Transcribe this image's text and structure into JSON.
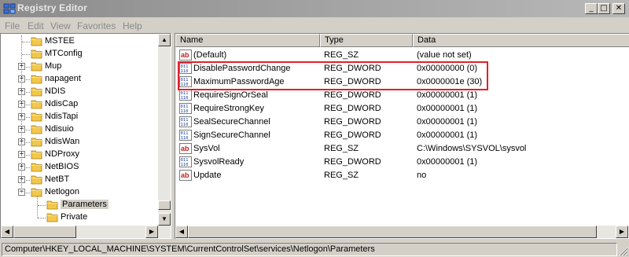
{
  "window": {
    "title": "Registry Editor",
    "controls": {
      "minimize": "_",
      "maximize": "□",
      "close": "✕"
    }
  },
  "menu": {
    "items": [
      "File",
      "Edit",
      "View",
      "Favorites",
      "Help"
    ]
  },
  "tree": {
    "items": [
      {
        "label": "MSTEE",
        "expandable": false,
        "level": 0,
        "selected": false
      },
      {
        "label": "MTConfig",
        "expandable": false,
        "level": 0,
        "selected": false
      },
      {
        "label": "Mup",
        "expandable": true,
        "level": 0,
        "selected": false
      },
      {
        "label": "napagent",
        "expandable": true,
        "level": 0,
        "selected": false
      },
      {
        "label": "NDIS",
        "expandable": true,
        "level": 0,
        "selected": false
      },
      {
        "label": "NdisCap",
        "expandable": true,
        "level": 0,
        "selected": false
      },
      {
        "label": "NdisTapi",
        "expandable": true,
        "level": 0,
        "selected": false
      },
      {
        "label": "Ndisuio",
        "expandable": true,
        "level": 0,
        "selected": false
      },
      {
        "label": "NdisWan",
        "expandable": true,
        "level": 0,
        "selected": false
      },
      {
        "label": "NDProxy",
        "expandable": true,
        "level": 0,
        "selected": false
      },
      {
        "label": "NetBIOS",
        "expandable": true,
        "level": 0,
        "selected": false
      },
      {
        "label": "NetBT",
        "expandable": true,
        "level": 0,
        "selected": false
      },
      {
        "label": "Netlogon",
        "expandable": true,
        "level": 0,
        "selected": false,
        "expanded": true
      },
      {
        "label": "Parameters",
        "expandable": false,
        "level": 1,
        "selected": true
      },
      {
        "label": "Private",
        "expandable": false,
        "level": 1,
        "selected": false
      }
    ]
  },
  "list": {
    "columns": [
      "Name",
      "Type",
      "Data"
    ],
    "rows": [
      {
        "name": "(Default)",
        "type": "REG_SZ",
        "data": "(value not set)",
        "icon": "string-value-icon"
      },
      {
        "name": "DisablePasswordChange",
        "type": "REG_DWORD",
        "data": "0x00000000 (0)",
        "icon": "binary-value-icon"
      },
      {
        "name": "MaximumPasswordAge",
        "type": "REG_DWORD",
        "data": "0x0000001e (30)",
        "icon": "binary-value-icon"
      },
      {
        "name": "RequireSignOrSeal",
        "type": "REG_DWORD",
        "data": "0x00000001 (1)",
        "icon": "binary-value-icon"
      },
      {
        "name": "RequireStrongKey",
        "type": "REG_DWORD",
        "data": "0x00000001 (1)",
        "icon": "binary-value-icon"
      },
      {
        "name": "SealSecureChannel",
        "type": "REG_DWORD",
        "data": "0x00000001 (1)",
        "icon": "binary-value-icon"
      },
      {
        "name": "SignSecureChannel",
        "type": "REG_DWORD",
        "data": "0x00000001 (1)",
        "icon": "binary-value-icon"
      },
      {
        "name": "SysVol",
        "type": "REG_SZ",
        "data": "C:\\Windows\\SYSVOL\\sysvol",
        "icon": "string-value-icon"
      },
      {
        "name": "SysvolReady",
        "type": "REG_DWORD",
        "data": "0x00000001 (1)",
        "icon": "binary-value-icon"
      },
      {
        "name": "Update",
        "type": "REG_SZ",
        "data": "no",
        "icon": "string-value-icon"
      }
    ]
  },
  "status": {
    "path": "Computer\\HKEY_LOCAL_MACHINE\\SYSTEM\\CurrentControlSet\\services\\Netlogon\\Parameters"
  },
  "colors": {
    "highlight_border": "#e0202a",
    "titlebar": "#9a9a9a",
    "folder": "#f2c84b"
  }
}
